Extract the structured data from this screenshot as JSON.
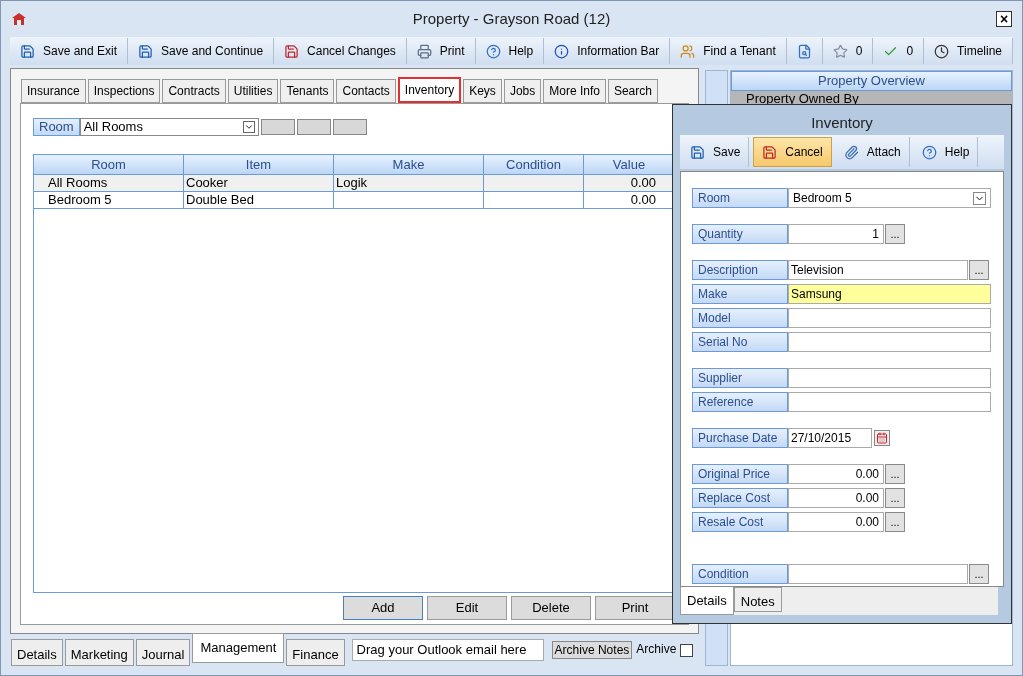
{
  "window": {
    "title": "Property  - Grayson Road (12)",
    "close": "×"
  },
  "toolbar": [
    {
      "kind": "labeled",
      "label": "Save and Exit"
    },
    {
      "kind": "labeled",
      "label": "Save and Continue"
    },
    {
      "kind": "labeled",
      "label": "Cancel Changes"
    },
    {
      "kind": "labeled",
      "label": "Print"
    },
    {
      "kind": "labeled",
      "label": "Help"
    },
    {
      "kind": "labeled",
      "label": "Information Bar"
    },
    {
      "kind": "labeled",
      "label": "Find a Tenant"
    },
    {
      "kind": "icon"
    },
    {
      "kind": "labeled",
      "label": "0"
    },
    {
      "kind": "labeled",
      "label": "0"
    },
    {
      "kind": "labeled",
      "label": "Timeline"
    }
  ],
  "tabs": [
    {
      "label": "Insurance",
      "selected": false
    },
    {
      "label": "Inspections",
      "selected": false
    },
    {
      "label": "Contracts",
      "selected": false
    },
    {
      "label": "Utilities",
      "selected": false
    },
    {
      "label": "Tenants",
      "selected": false
    },
    {
      "label": "Contacts",
      "selected": false
    },
    {
      "label": "Inventory",
      "selected": true
    },
    {
      "label": "Keys",
      "selected": false
    },
    {
      "label": "Jobs",
      "selected": false
    },
    {
      "label": "More Info",
      "selected": false
    },
    {
      "label": "Search",
      "selected": false
    }
  ],
  "room_filter": {
    "label": "Room",
    "value": "All Rooms"
  },
  "table": {
    "columns": [
      "Room",
      "Item",
      "Make",
      "Condition",
      "Value"
    ],
    "rows": [
      {
        "cells": [
          "All Rooms",
          "Cooker",
          "Logik",
          "",
          "0.00"
        ],
        "selected": true
      },
      {
        "cells": [
          "Bedroom 5",
          "Double Bed",
          "",
          "",
          "0.00"
        ],
        "selected": false
      }
    ]
  },
  "actions": [
    "Add",
    "Edit",
    "Delete",
    "Print"
  ],
  "bottom_tabs": [
    {
      "label": "Details",
      "selected": false
    },
    {
      "label": "Marketing",
      "selected": false
    },
    {
      "label": "Journal",
      "selected": false
    },
    {
      "label": "Management",
      "selected": true
    },
    {
      "label": "Finance",
      "selected": false
    }
  ],
  "drop_zone": "Drag your Outlook email here",
  "archive_notes": "Archive Notes",
  "archive": {
    "label": "Archive",
    "checked": false
  },
  "overview": {
    "title": "Property Overview",
    "row": "Property Owned By"
  },
  "dialog": {
    "title": "Inventory",
    "toolbar": [
      {
        "label": "Save",
        "highlighted": false
      },
      {
        "label": "Cancel",
        "highlighted": true
      },
      {
        "label": "Attach",
        "highlighted": false
      },
      {
        "label": "Help",
        "highlighted": false
      }
    ],
    "groups": [
      [
        {
          "label": "Room",
          "value": "Bedroom 5",
          "kind": "select"
        }
      ],
      [
        {
          "label": "Quantity",
          "value": "1",
          "kind": "number",
          "button": "..."
        }
      ],
      [
        {
          "label": "Description",
          "value": "Television",
          "kind": "wide",
          "button": "..."
        },
        {
          "label": "Make",
          "value": "Samsung",
          "kind": "text",
          "focused": true
        },
        {
          "label": "Model",
          "kind": "text"
        },
        {
          "label": "Serial No",
          "kind": "text"
        }
      ],
      [
        {
          "label": "Supplier",
          "kind": "text"
        },
        {
          "label": "Reference",
          "kind": "text"
        }
      ],
      [
        {
          "label": "Purchase Date",
          "value": "27/10/2015",
          "kind": "date"
        }
      ],
      [
        {
          "label": "Original Price",
          "value": "0.00",
          "kind": "number",
          "button": "..."
        },
        {
          "label": "Replace Cost",
          "value": "0.00",
          "kind": "number",
          "button": "..."
        },
        {
          "label": "Resale Cost",
          "value": "0.00",
          "kind": "number",
          "button": "..."
        }
      ],
      [
        {
          "label": "Condition",
          "kind": "wide",
          "button": "..."
        }
      ]
    ],
    "tabs": [
      {
        "label": "Details",
        "selected": true
      },
      {
        "label": "Notes",
        "selected": false
      }
    ]
  }
}
